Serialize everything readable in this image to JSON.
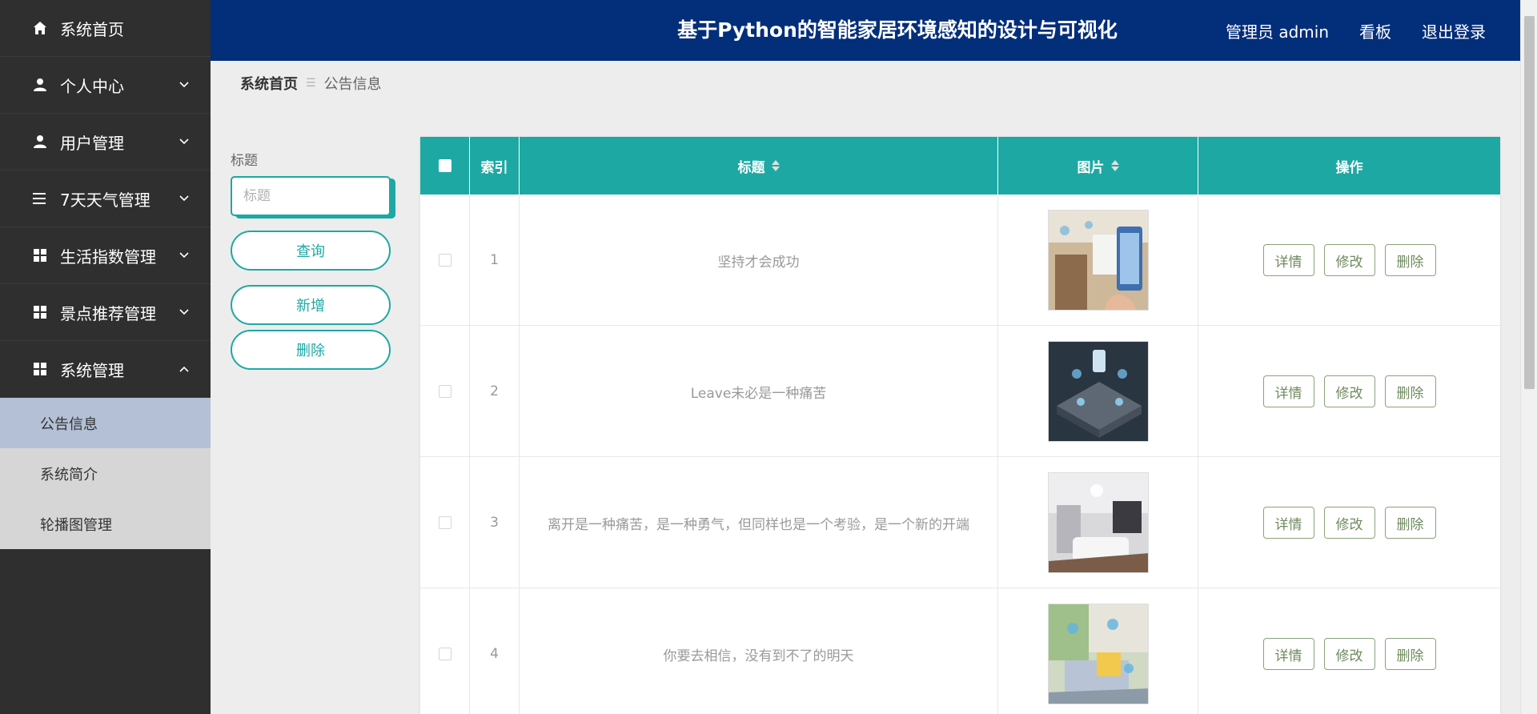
{
  "sidebar": {
    "items": [
      {
        "label": "系统首页",
        "icon": "home-icon",
        "has_children": false
      },
      {
        "label": "个人中心",
        "icon": "user-icon",
        "has_children": true
      },
      {
        "label": "用户管理",
        "icon": "user-icon",
        "has_children": true
      },
      {
        "label": "7天天气管理",
        "icon": "list-icon",
        "has_children": true
      },
      {
        "label": "生活指数管理",
        "icon": "grid-icon",
        "has_children": true
      },
      {
        "label": "景点推荐管理",
        "icon": "grid-icon",
        "has_children": true
      },
      {
        "label": "系统管理",
        "icon": "grid-icon",
        "has_children": true,
        "expanded": true
      }
    ],
    "submenu": [
      {
        "label": "公告信息",
        "active": true
      },
      {
        "label": "系统简介",
        "active": false
      },
      {
        "label": "轮播图管理",
        "active": false
      }
    ]
  },
  "header": {
    "title": "基于Python的智能家居环境感知的设计与可视化",
    "user": "管理员 admin",
    "board": "看板",
    "logout": "退出登录"
  },
  "breadcrumb": {
    "home": "系统首页",
    "current": "公告信息"
  },
  "search": {
    "label": "标题",
    "placeholder": "标题",
    "query_button": "查询",
    "add_button": "新增",
    "delete_button": "删除"
  },
  "table": {
    "columns": [
      "索引",
      "标题",
      "图片",
      "操作"
    ],
    "rows": [
      {
        "index": "1",
        "title": "坚持才会成功"
      },
      {
        "index": "2",
        "title": "Leave未必是一种痛苦"
      },
      {
        "index": "3",
        "title": "离开是一种痛苦，是一种勇气，但同样也是一个考验，是一个新的开端"
      },
      {
        "index": "4",
        "title": "你要去相信，没有到不了的明天"
      }
    ],
    "actions": {
      "detail": "详情",
      "edit": "修改",
      "delete": "删除"
    }
  },
  "colors": {
    "sidebar_bg": "#2f2f2f",
    "header_bg": "#032e7a",
    "accent": "#1ea8a3",
    "active_submenu": "#b3c0d6"
  }
}
